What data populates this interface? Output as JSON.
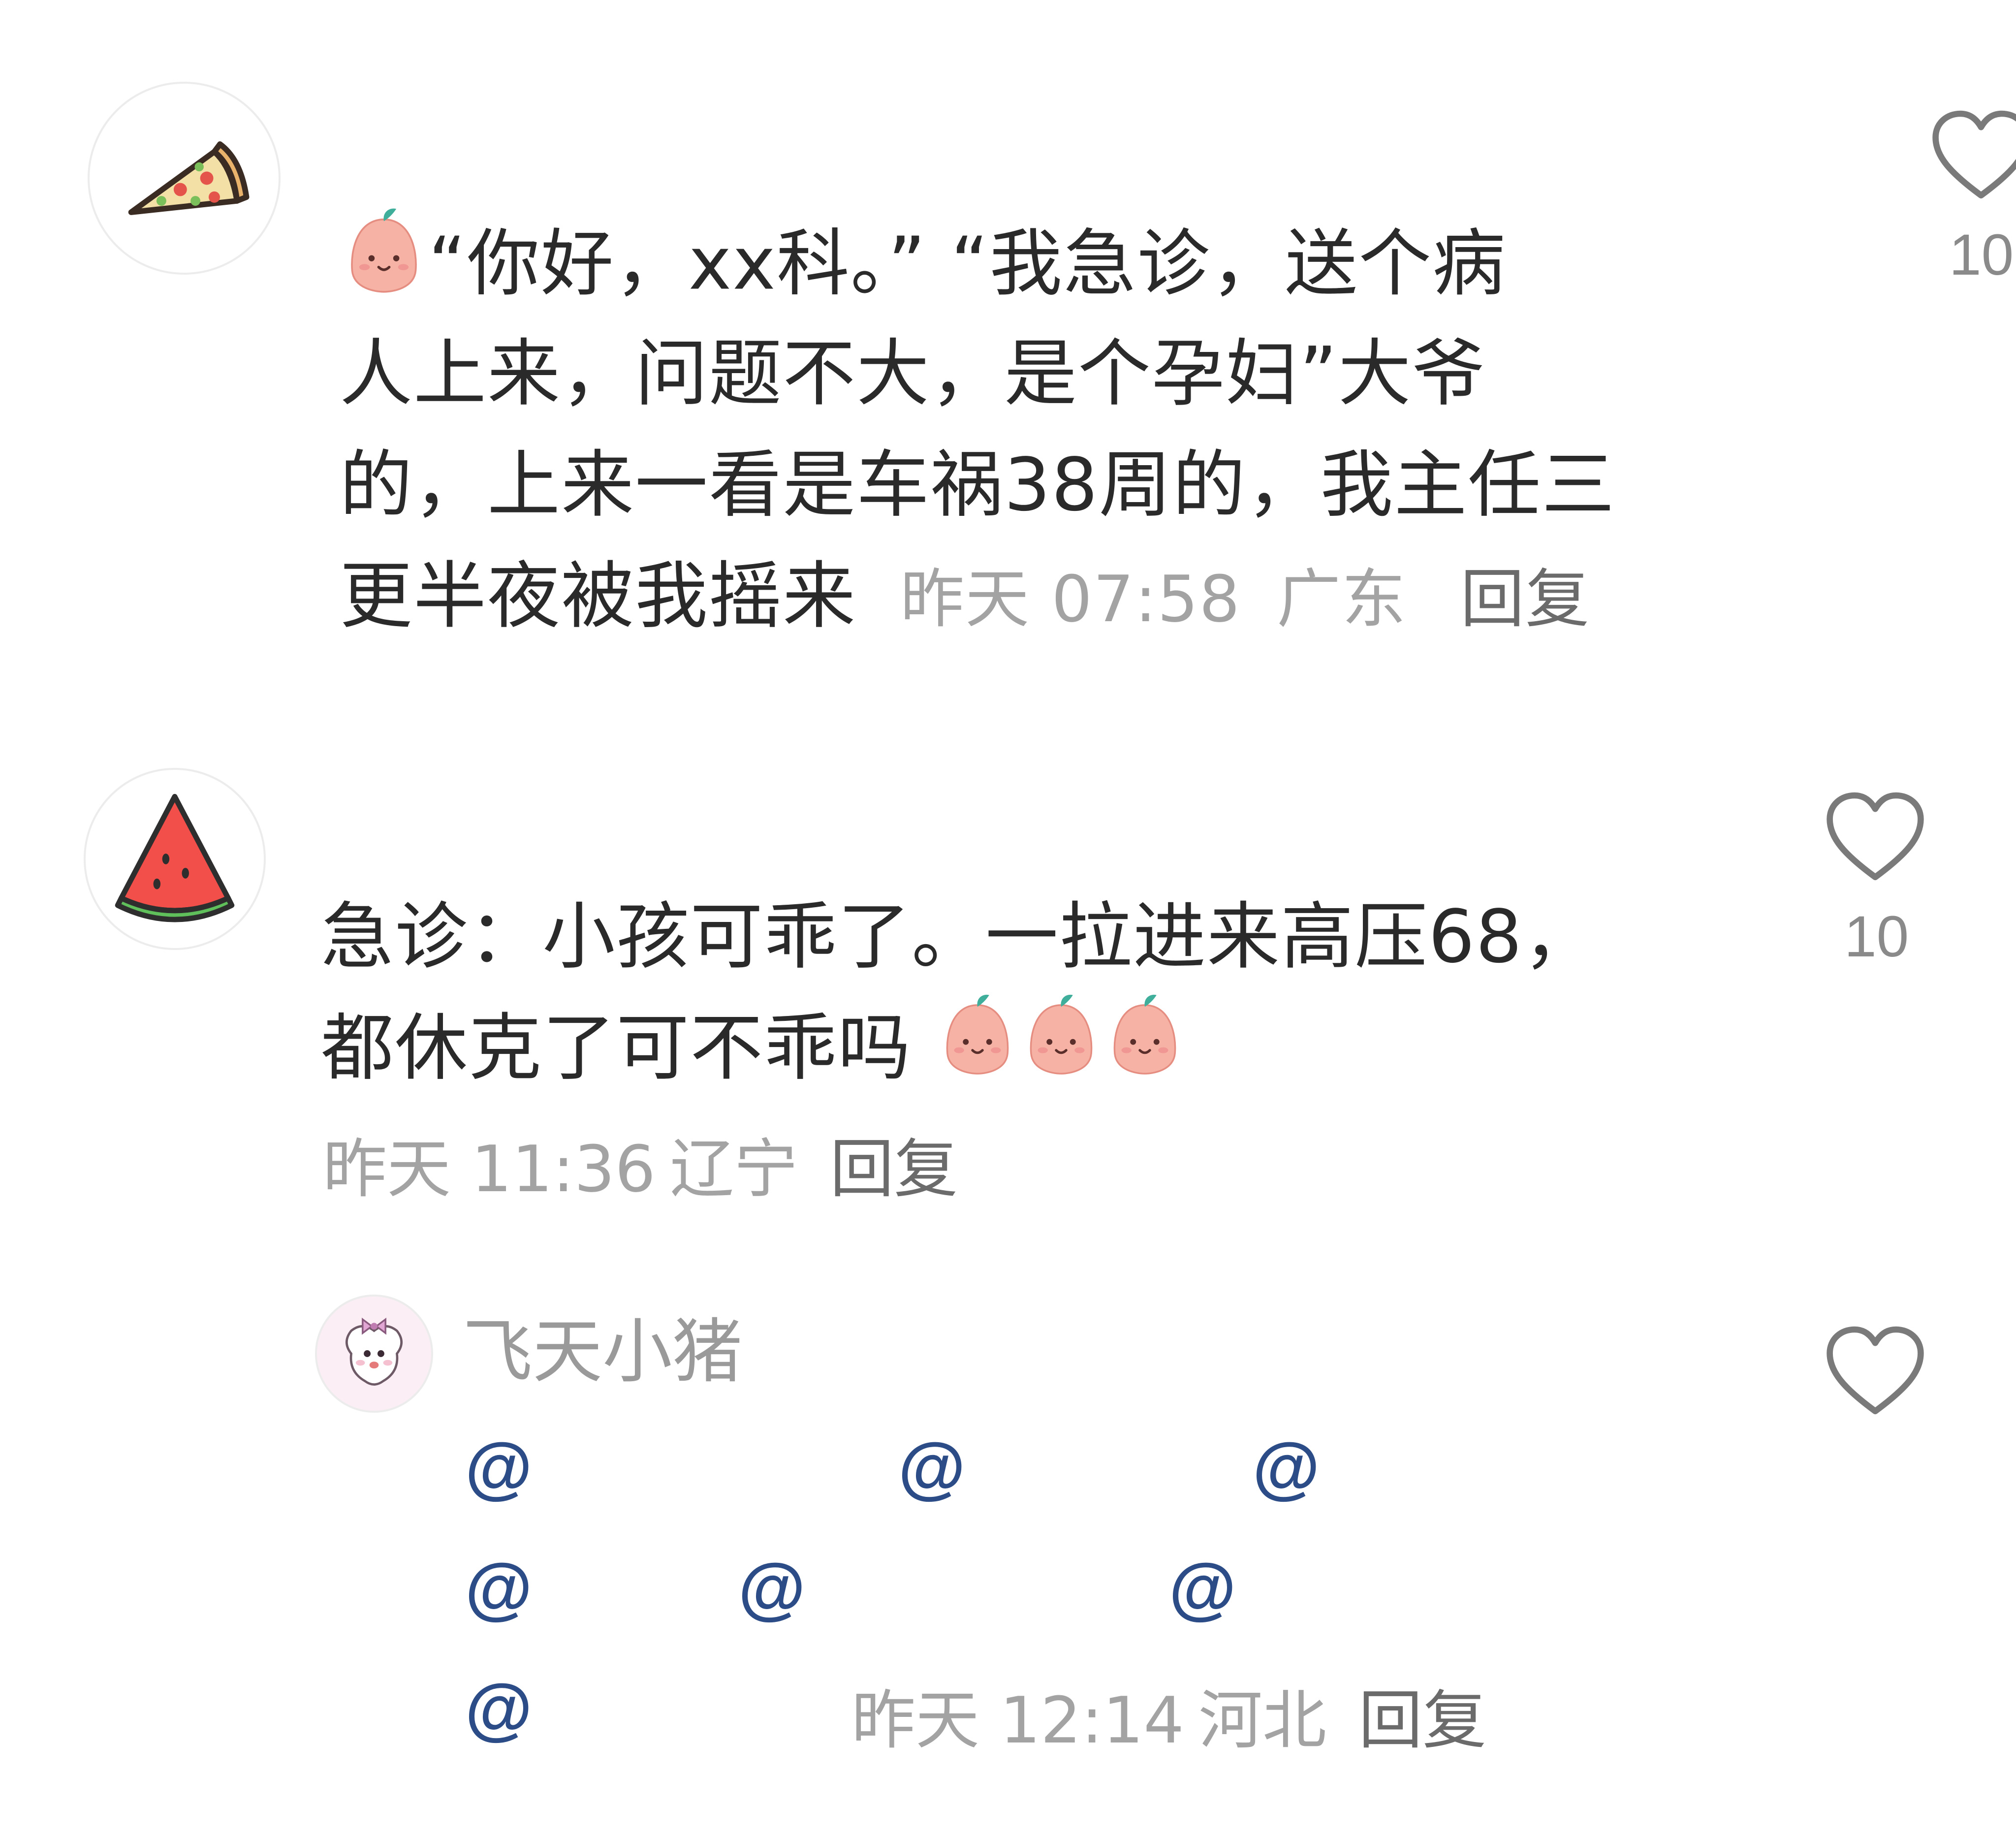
{
  "comments": [
    {
      "avatar_icon": "pizza-slice-icon",
      "lines": [
        "“你好，xx科。” “我急诊，送个病",
        "人上来，问题不大，是个孕妇”大爷",
        "的，上来一看是车祸38周的，我主任三",
        "更半夜被我摇来"
      ],
      "timestamp": "昨天 07:58",
      "location": "广东",
      "reply_label": "回复",
      "like_count": "10"
    },
    {
      "avatar_icon": "watermelon-slice-icon",
      "lines": [
        "急诊：小孩可乖了。一拉进来高压68，",
        "都休克了可不乖吗"
      ],
      "timestamp": "昨天 11:36",
      "location": "辽宁",
      "reply_label": "回复",
      "like_count": "10"
    }
  ],
  "reply": {
    "avatar_icon": "cartoon-sheep-avatar-icon",
    "username": "飞天小猪",
    "mention_symbol": "@",
    "timestamp": "昨天 12:14",
    "location": "河北",
    "reply_label": "回复"
  },
  "colors": {
    "emoji_face": "#f6b3a5",
    "emoji_leaf": "#3fae9a",
    "mention": "#2b4c86",
    "meta_gray": "#a3a3a3"
  }
}
